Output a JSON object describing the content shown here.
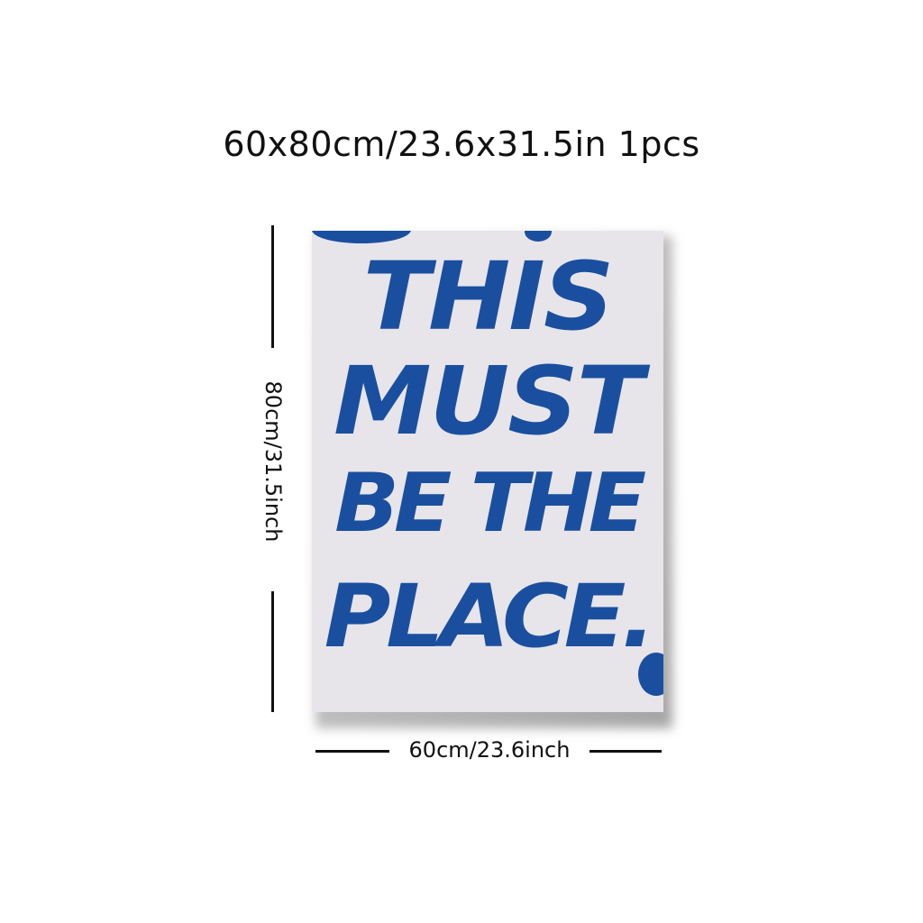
{
  "product": {
    "title": "60x80cm/23.6x31.5in 1pcs"
  },
  "poster": {
    "lines": [
      "THIS",
      "MUST",
      "BE THE",
      "PLACE."
    ],
    "ink_color": "#1a4fa0",
    "background_color": "#e7e5ea"
  },
  "dimensions": {
    "height_label": "80cm/31.5inch",
    "width_label": "60cm/23.6inch"
  }
}
